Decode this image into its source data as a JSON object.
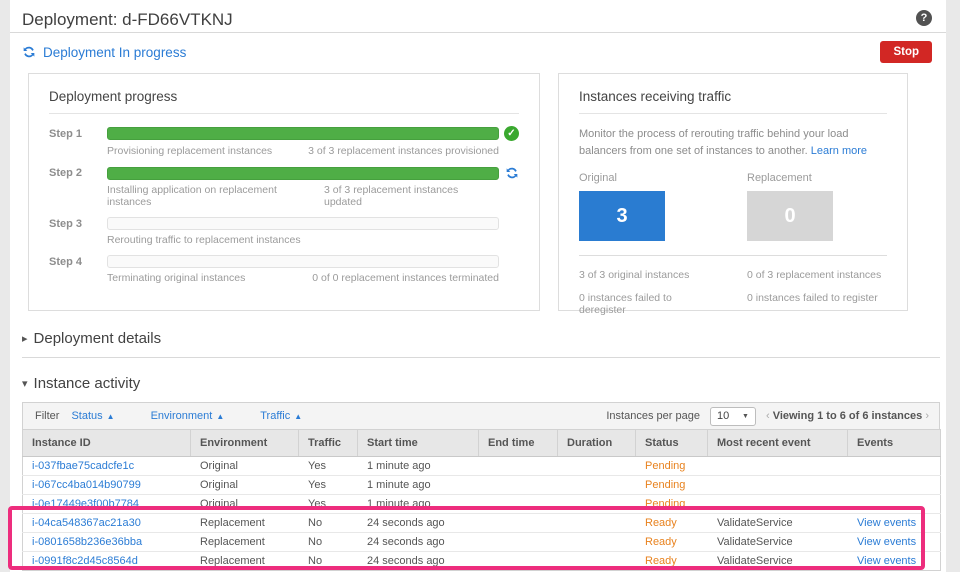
{
  "page": {
    "title": "Deployment: d-FD66VTKNJ",
    "help_icon": "?"
  },
  "status_bar": {
    "label": "Deployment In progress",
    "stop_button": "Stop"
  },
  "progress_panel": {
    "title": "Deployment progress",
    "steps": [
      {
        "label": "Step 1",
        "desc": "Provisioning replacement instances",
        "detail": "3 of 3 replacement instances provisioned",
        "fill_percent": 100,
        "icon": "check-circle"
      },
      {
        "label": "Step 2",
        "desc": "Installing application on replacement instances",
        "detail": "3 of 3 replacement instances updated",
        "fill_percent": 100,
        "icon": "refresh"
      },
      {
        "label": "Step 3",
        "desc": "Rerouting traffic to replacement instances",
        "detail": "",
        "fill_percent": 0,
        "icon": "none"
      },
      {
        "label": "Step 4",
        "desc": "Terminating original instances",
        "detail": "0 of 0 replacement instances terminated",
        "fill_percent": 0,
        "icon": "none"
      }
    ]
  },
  "traffic_panel": {
    "title": "Instances receiving traffic",
    "description": "Monitor the process of rerouting traffic behind your load balancers from one set of instances to another.",
    "learn_more": "Learn more",
    "original": {
      "label": "Original",
      "count": "3",
      "stat1": "3 of 3 original instances",
      "stat2": "0 instances failed to deregister"
    },
    "replacement": {
      "label": "Replacement",
      "count": "0",
      "stat1": "0 of 3 replacement instances",
      "stat2": "0 instances failed to register"
    }
  },
  "sections": {
    "deployment_details": "Deployment details",
    "instance_activity": "Instance activity"
  },
  "filter_bar": {
    "filter_label": "Filter",
    "filters": [
      {
        "label": "Status"
      },
      {
        "label": "Environment"
      },
      {
        "label": "Traffic"
      }
    ],
    "per_page_label": "Instances per page",
    "per_page_value": "10",
    "paging_text": "Viewing 1 to 6 of 6 instances",
    "prev_chevron": "‹",
    "next_chevron": "›"
  },
  "table": {
    "columns": [
      "Instance ID",
      "Environment",
      "Traffic",
      "Start time",
      "End time",
      "Duration",
      "Status",
      "Most recent event",
      "Events"
    ],
    "rows": [
      {
        "instance_id": "i-037fbae75cadcfe1c",
        "environment": "Original",
        "traffic": "Yes",
        "start_time": "1 minute ago",
        "end_time": "",
        "duration": "",
        "status": "Pending",
        "most_recent_event": "",
        "events": ""
      },
      {
        "instance_id": "i-067cc4ba014b90799",
        "environment": "Original",
        "traffic": "Yes",
        "start_time": "1 minute ago",
        "end_time": "",
        "duration": "",
        "status": "Pending",
        "most_recent_event": "",
        "events": ""
      },
      {
        "instance_id": "i-0e17449e3f00b7784",
        "environment": "Original",
        "traffic": "Yes",
        "start_time": "1 minute ago",
        "end_time": "",
        "duration": "",
        "status": "Pending",
        "most_recent_event": "",
        "events": ""
      },
      {
        "instance_id": "i-04ca548367ac21a30",
        "environment": "Replacement",
        "traffic": "No",
        "start_time": "24 seconds ago",
        "end_time": "",
        "duration": "",
        "status": "Ready",
        "most_recent_event": "ValidateService",
        "events": "View events"
      },
      {
        "instance_id": "i-0801658b236e36bba",
        "environment": "Replacement",
        "traffic": "No",
        "start_time": "24 seconds ago",
        "end_time": "",
        "duration": "",
        "status": "Ready",
        "most_recent_event": "ValidateService",
        "events": "View events"
      },
      {
        "instance_id": "i-0991f8c2d45c8564d",
        "environment": "Replacement",
        "traffic": "No",
        "start_time": "24 seconds ago",
        "end_time": "",
        "duration": "",
        "status": "Ready",
        "most_recent_event": "ValidateService",
        "events": "View events"
      }
    ]
  },
  "colors": {
    "link_blue": "#2b7cd5",
    "bar_green": "#4fae46",
    "status_orange": "#e8821e",
    "stop_red": "#d22724",
    "original_box_blue": "#2a7cd1",
    "replacement_box_gray": "#d6d6d6",
    "highlight_pink": "#ed2d7d"
  }
}
